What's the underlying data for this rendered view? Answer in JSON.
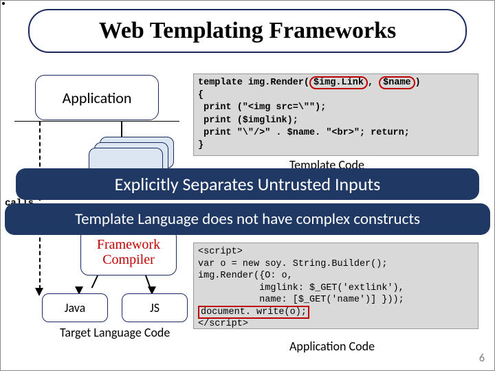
{
  "title": "Web Templating Frameworks",
  "application_label": "Application",
  "calls_label": "calls",
  "framework_line1": "Framework",
  "framework_line2": "Compiler",
  "java_label": "Java",
  "js_label": "JS",
  "target_lang_label": "Target Language Code",
  "template_code_label": "Template Code",
  "app_code_label": "Application Code",
  "banner1": "Explicitly Separates Untrusted Inputs",
  "banner2": "Template Language does not have complex constructs",
  "code_top_prefix": "template img.Render(",
  "code_top_arg1": "$img.Link",
  "code_top_sep": ", ",
  "code_top_arg2": "$name",
  "code_top_suffix": ")",
  "code_top_body": "{\n print (\"<img src=\\\"\");\n print ($imglink);\n print \"\\\"/>\" . $name. \"<br>\"; return;\n}",
  "code_bottom_pre": "<script>\nvar o = new soy. String.Builder();\nimg.Render({O: o,\n           imglink: $_GET('extlink'),\n           name: [$_GET('name')] }));\n",
  "code_bottom_hl": "document. write(o);",
  "code_bottom_post": "\n</scr",
  "code_bottom_post2": "ipt>",
  "page_number": "6"
}
